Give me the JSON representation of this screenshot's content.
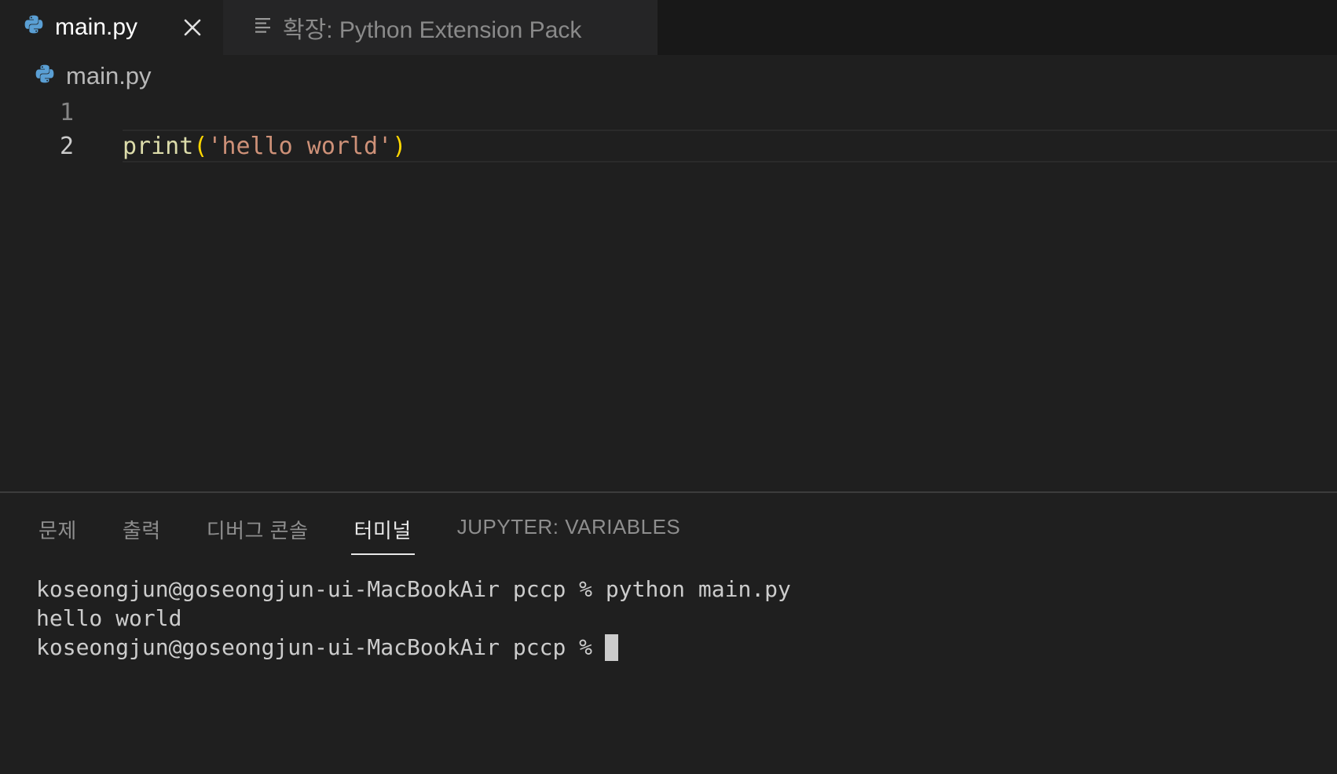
{
  "tabs": [
    {
      "label": "main.py",
      "icon": "python-icon",
      "active": true
    },
    {
      "label": "확장: Python Extension Pack",
      "icon": "extension-details-icon",
      "active": false
    }
  ],
  "breadcrumb": {
    "label": "main.py",
    "icon": "python-icon"
  },
  "editor": {
    "lines": [
      {
        "number": "1",
        "code": ""
      },
      {
        "number": "2",
        "fn": "print",
        "open": "(",
        "str": "'hello world'",
        "close": ")"
      }
    ]
  },
  "panel": {
    "tabs": [
      "문제",
      "출력",
      "디버그 콘솔",
      "터미널",
      "JUPYTER: VARIABLES"
    ],
    "active_tab": "터미널"
  },
  "terminal": {
    "lines": [
      "koseongjun@goseongjun-ui-MacBookAir pccp % python main.py",
      "hello world",
      "koseongjun@goseongjun-ui-MacBookAir pccp %"
    ]
  },
  "colors": {
    "background": "#1f1f1f",
    "python_blue": "#5a9fd4",
    "fn": "#dcdcaa",
    "paren": "#ffd700",
    "string": "#ce9178"
  }
}
